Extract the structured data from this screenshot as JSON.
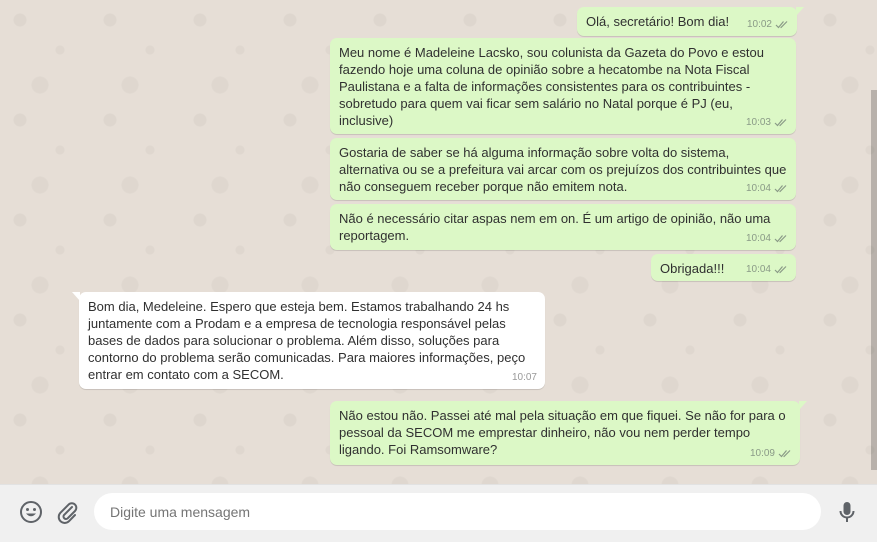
{
  "messages": [
    {
      "direction": "out",
      "text": "Olá, secretário! Bom dia!",
      "time": "10:02",
      "read": true
    },
    {
      "direction": "out",
      "text": "Meu nome é Madeleine Lacsko, sou colunista da Gazeta do Povo e estou fazendo hoje uma coluna de opinião sobre a hecatombe na Nota Fiscal Paulistana e a falta de informações consistentes para os contribuintes - sobretudo para quem vai ficar sem salário no Natal porque é PJ (eu, inclusive)",
      "time": "10:03",
      "read": true
    },
    {
      "direction": "out",
      "text": "Gostaria de saber se há alguma informação sobre volta do sistema, alternativa ou se a prefeitura vai arcar com os prejuízos dos contribuintes que não conseguem receber porque não emitem nota.",
      "time": "10:04",
      "read": true
    },
    {
      "direction": "out",
      "text": "Não é necessário citar aspas nem em on. É um artigo de opinião, não uma reportagem.",
      "time": "10:04",
      "read": true
    },
    {
      "direction": "out",
      "text": "Obrigada!!!",
      "time": "10:04",
      "read": true
    },
    {
      "direction": "in",
      "text": "Bom dia, Medeleine. Espero que esteja bem. Estamos trabalhando 24 hs juntamente com a Prodam e a empresa de tecnologia responsável pelas bases de dados para solucionar o problema. Além disso, soluções para contorno do problema serão comunicadas. Para maiores informações, peço entrar em contato com a SECOM.",
      "time": "10:07",
      "read": false
    },
    {
      "direction": "out",
      "text": "Não estou não. Passei até mal pela situação em que fiquei. Se não for para o pessoal da SECOM me emprestar dinheiro, não vou nem perder tempo ligando. Foi Ramsomware?",
      "time": "10:09",
      "read": true
    }
  ],
  "composer": {
    "placeholder": "Digite uma mensagem",
    "emoji_icon": "emoji-icon",
    "attach_icon": "paperclip-icon",
    "mic_icon": "microphone-icon"
  },
  "colors": {
    "outgoing_bubble": "#dcf8c6",
    "incoming_bubble": "#ffffff",
    "read_ticks": "#8a9a87"
  }
}
